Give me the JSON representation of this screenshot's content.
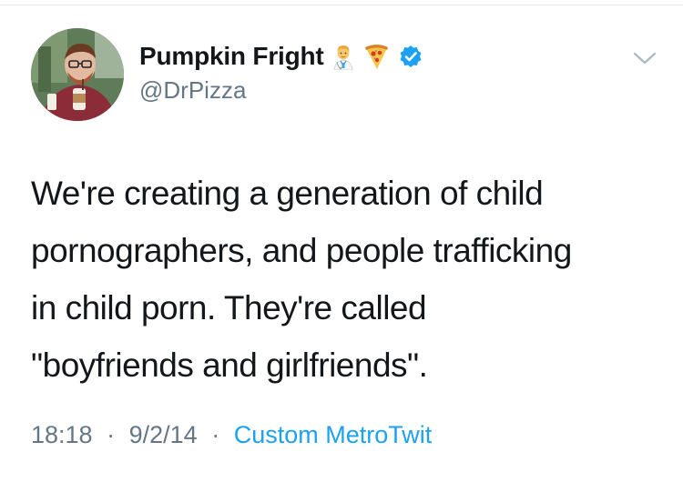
{
  "user": {
    "display_name": "Pumpkin Fright",
    "handle": "@DrPizza",
    "emoji_icons": [
      "man-health-worker-icon",
      "pizza-icon"
    ],
    "verified": true
  },
  "tweet": {
    "lines": [
      "We're creating a generation of child",
      "pornographers, and people trafficking",
      "in child porn. They're called",
      "\"boyfriends and girlfriends\"."
    ]
  },
  "meta": {
    "time": "18:18",
    "separator": "·",
    "date": "9/2/14",
    "source": "Custom MetroTwit"
  },
  "colors": {
    "text": "#14171a",
    "muted": "#657786",
    "link": "#1da1f2",
    "verified": "#1da1f2"
  }
}
